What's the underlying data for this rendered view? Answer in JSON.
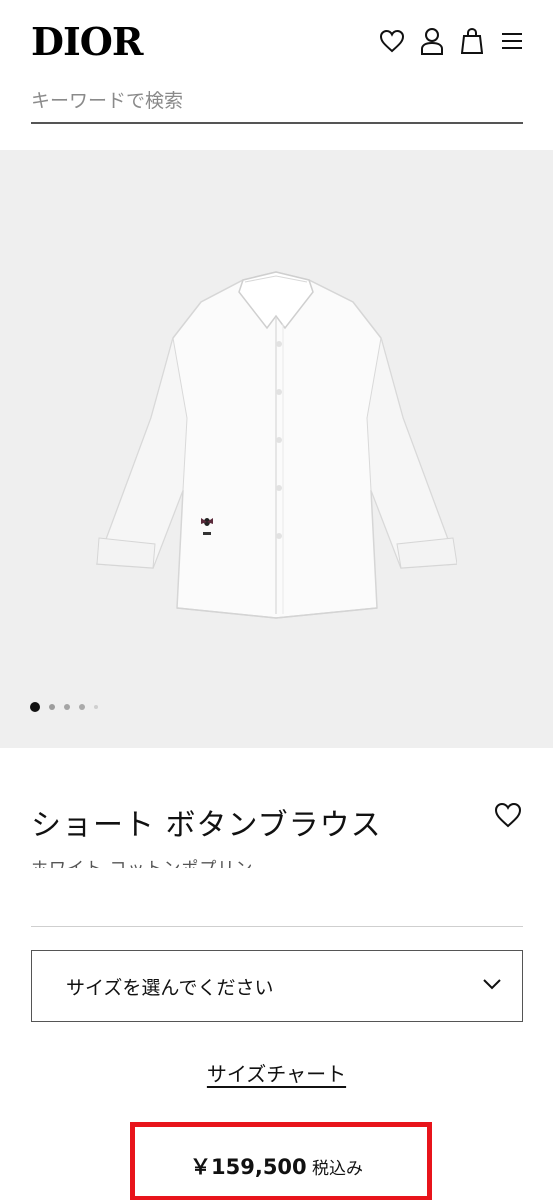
{
  "header": {
    "logo": "DIOR",
    "icons": [
      "heart-icon",
      "user-icon",
      "shopping-bag-icon",
      "menu-icon"
    ]
  },
  "search": {
    "placeholder": "キーワードで検索",
    "value": ""
  },
  "gallery": {
    "slide_count": 5,
    "active_slide": 0
  },
  "product": {
    "title": "ショート ボタンブラウス",
    "subtitle": "ホワイト コットンポプリン",
    "size_select": {
      "placeholder": "サイズを選んでください"
    },
    "size_chart_link": "サイズチャート",
    "price": "￥159,500",
    "tax_note": "税込み"
  },
  "colors": {
    "highlight": "#e8141b",
    "image_background": "#efefef"
  }
}
